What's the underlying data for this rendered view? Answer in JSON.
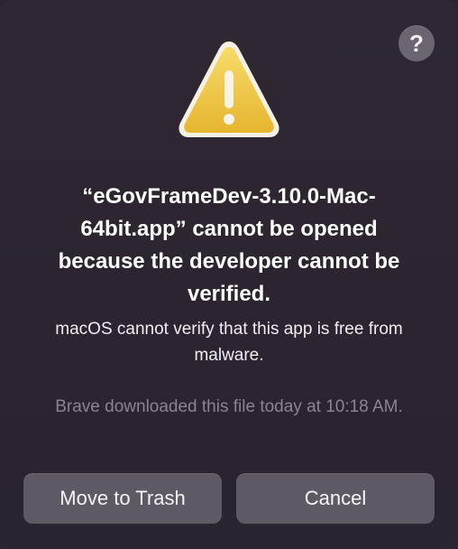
{
  "help_button": {
    "label": "?"
  },
  "dialog": {
    "title": "“eGovFrameDev-3.10.0-Mac-64bit.app” cannot be opened because the developer cannot be verified.",
    "message": "macOS cannot verify that this app is free from malware.",
    "source_note": "Brave downloaded this file today at 10:18 AM."
  },
  "buttons": {
    "move_to_trash": "Move to Trash",
    "cancel": "Cancel"
  },
  "icons": {
    "warning": "warning-icon",
    "help": "question-icon"
  }
}
